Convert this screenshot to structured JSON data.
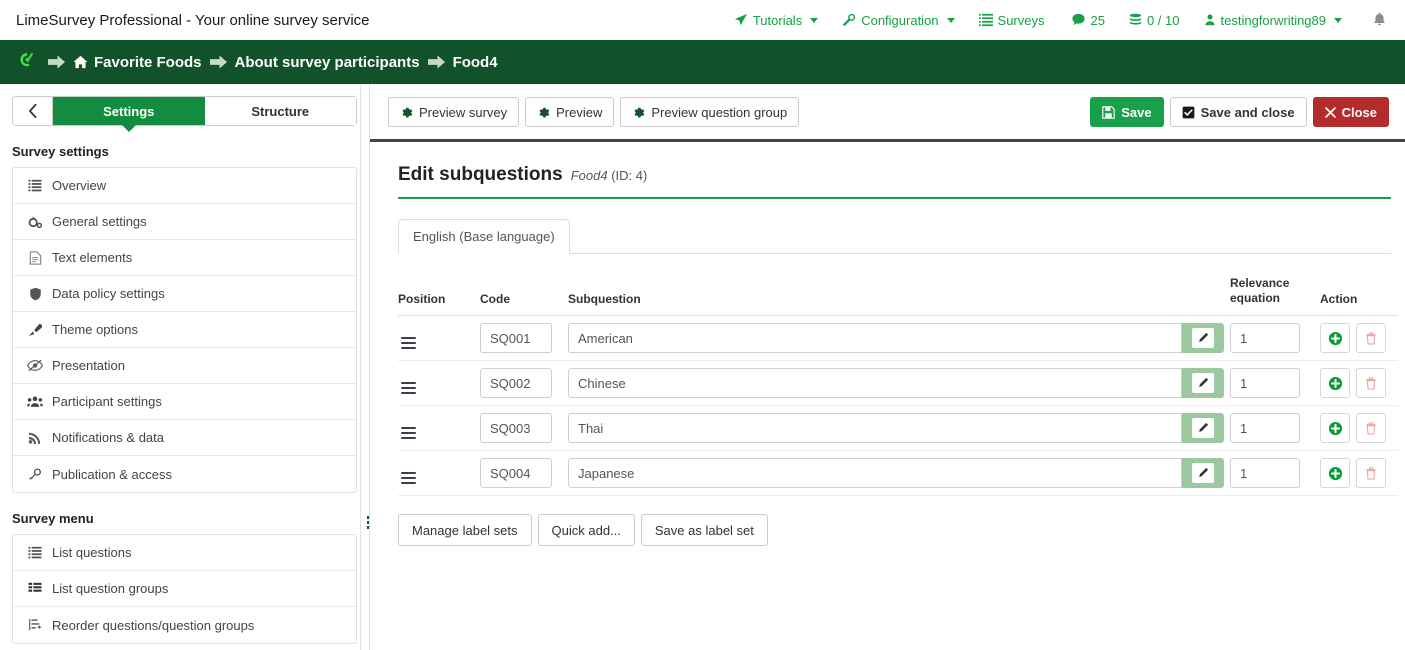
{
  "topbar": {
    "brand_title": "LimeSurvey Professional - Your online survey service",
    "nav": [
      {
        "label": "Tutorials",
        "icon": "rocket-icon",
        "caret": true
      },
      {
        "label": "Configuration",
        "icon": "wrench-icon",
        "caret": true
      },
      {
        "label": "Surveys",
        "icon": "list-icon",
        "caret": true
      },
      {
        "label": "25",
        "icon": "comment-icon",
        "caret": false
      },
      {
        "label": "0 / 10",
        "icon": "database-icon",
        "caret": false
      },
      {
        "label": "testingforwriting89",
        "icon": "user-icon",
        "caret": true
      }
    ],
    "bell_icon": "bell-icon",
    "accent_color": "#17a046"
  },
  "breadcrumb": {
    "logo_icon": "limesurvey-logo-icon",
    "bar_color": "#11522a",
    "items": [
      {
        "label": "Favorite Foods",
        "icon": "home-icon"
      },
      {
        "label": "About survey participants",
        "icon": ""
      },
      {
        "label": "Food4",
        "icon": ""
      }
    ]
  },
  "sidebar": {
    "back_icon": "chevron-left-icon",
    "tabs": [
      {
        "label": "Settings",
        "active": true
      },
      {
        "label": "Structure",
        "active": false
      }
    ],
    "groups": [
      {
        "heading": "Survey settings",
        "items": [
          {
            "label": "Overview",
            "icon": "list-icon"
          },
          {
            "label": "General settings",
            "icon": "gears-icon"
          },
          {
            "label": "Text elements",
            "icon": "file-text-icon"
          },
          {
            "label": "Data policy settings",
            "icon": "shield-icon"
          },
          {
            "label": "Theme options",
            "icon": "paintbrush-icon"
          },
          {
            "label": "Presentation",
            "icon": "eye-slash-icon"
          },
          {
            "label": "Participant settings",
            "icon": "users-icon"
          },
          {
            "label": "Notifications & data",
            "icon": "rss-icon"
          },
          {
            "label": "Publication & access",
            "icon": "key-icon"
          }
        ]
      },
      {
        "heading": "Survey menu",
        "items": [
          {
            "label": "List questions",
            "icon": "list-icon"
          },
          {
            "label": "List question groups",
            "icon": "th-list-icon"
          },
          {
            "label": "Reorder questions/question groups",
            "icon": "reorder-icon"
          }
        ]
      }
    ],
    "drag_handle_icon": "vertical-dots-drag-icon"
  },
  "main": {
    "toolbar_left": [
      {
        "label": "Preview survey",
        "icon": "gear-icon"
      },
      {
        "label": "Preview",
        "icon": "gear-icon"
      },
      {
        "label": "Preview question group",
        "icon": "gear-icon"
      }
    ],
    "toolbar_right": [
      {
        "label": "Save",
        "icon": "floppy-icon",
        "style": "green"
      },
      {
        "label": "Save and close",
        "icon": "check-square-icon",
        "style": "white"
      },
      {
        "label": "Close",
        "icon": "times-icon",
        "style": "red"
      }
    ],
    "page_title": "Edit subquestions",
    "page_subtitle_name": "Food4",
    "page_subtitle_id": "(ID: 4)",
    "language_tabs": [
      {
        "label": "English (Base language)",
        "active": true
      }
    ],
    "table": {
      "headers": {
        "position": "Position",
        "code": "Code",
        "subquestion": "Subquestion",
        "relevance": "Relevance equation",
        "relevance_line1": "Relevance",
        "relevance_line2": "equation",
        "action": "Action"
      },
      "rows": [
        {
          "drag_icon": "drag-handle-icon",
          "code": "SQ001",
          "subquestion": "American",
          "relevance": "1",
          "edit_icon": "pencil-icon",
          "add_icon": "plus-circle-icon",
          "delete_icon": "trash-icon"
        },
        {
          "drag_icon": "drag-handle-icon",
          "code": "SQ002",
          "subquestion": "Chinese",
          "relevance": "1",
          "edit_icon": "pencil-icon",
          "add_icon": "plus-circle-icon",
          "delete_icon": "trash-icon"
        },
        {
          "drag_icon": "drag-handle-icon",
          "code": "SQ003",
          "subquestion": "Thai",
          "relevance": "1",
          "edit_icon": "pencil-icon",
          "add_icon": "plus-circle-icon",
          "delete_icon": "trash-icon"
        },
        {
          "drag_icon": "drag-handle-icon",
          "code": "SQ004",
          "subquestion": "Japanese",
          "relevance": "1",
          "edit_icon": "pencil-icon",
          "add_icon": "plus-circle-icon",
          "delete_icon": "trash-icon"
        }
      ]
    },
    "bottom_buttons": [
      {
        "label": "Manage label sets"
      },
      {
        "label": "Quick add..."
      },
      {
        "label": "Save as label set"
      }
    ]
  },
  "colors": {
    "green_dark": "#11522a",
    "green_primary": "#128c3e",
    "green_bright": "#19a04a",
    "red": "#b32b2b",
    "edit_green": "#9cc89f",
    "title_underline": "#1f9e4a"
  }
}
